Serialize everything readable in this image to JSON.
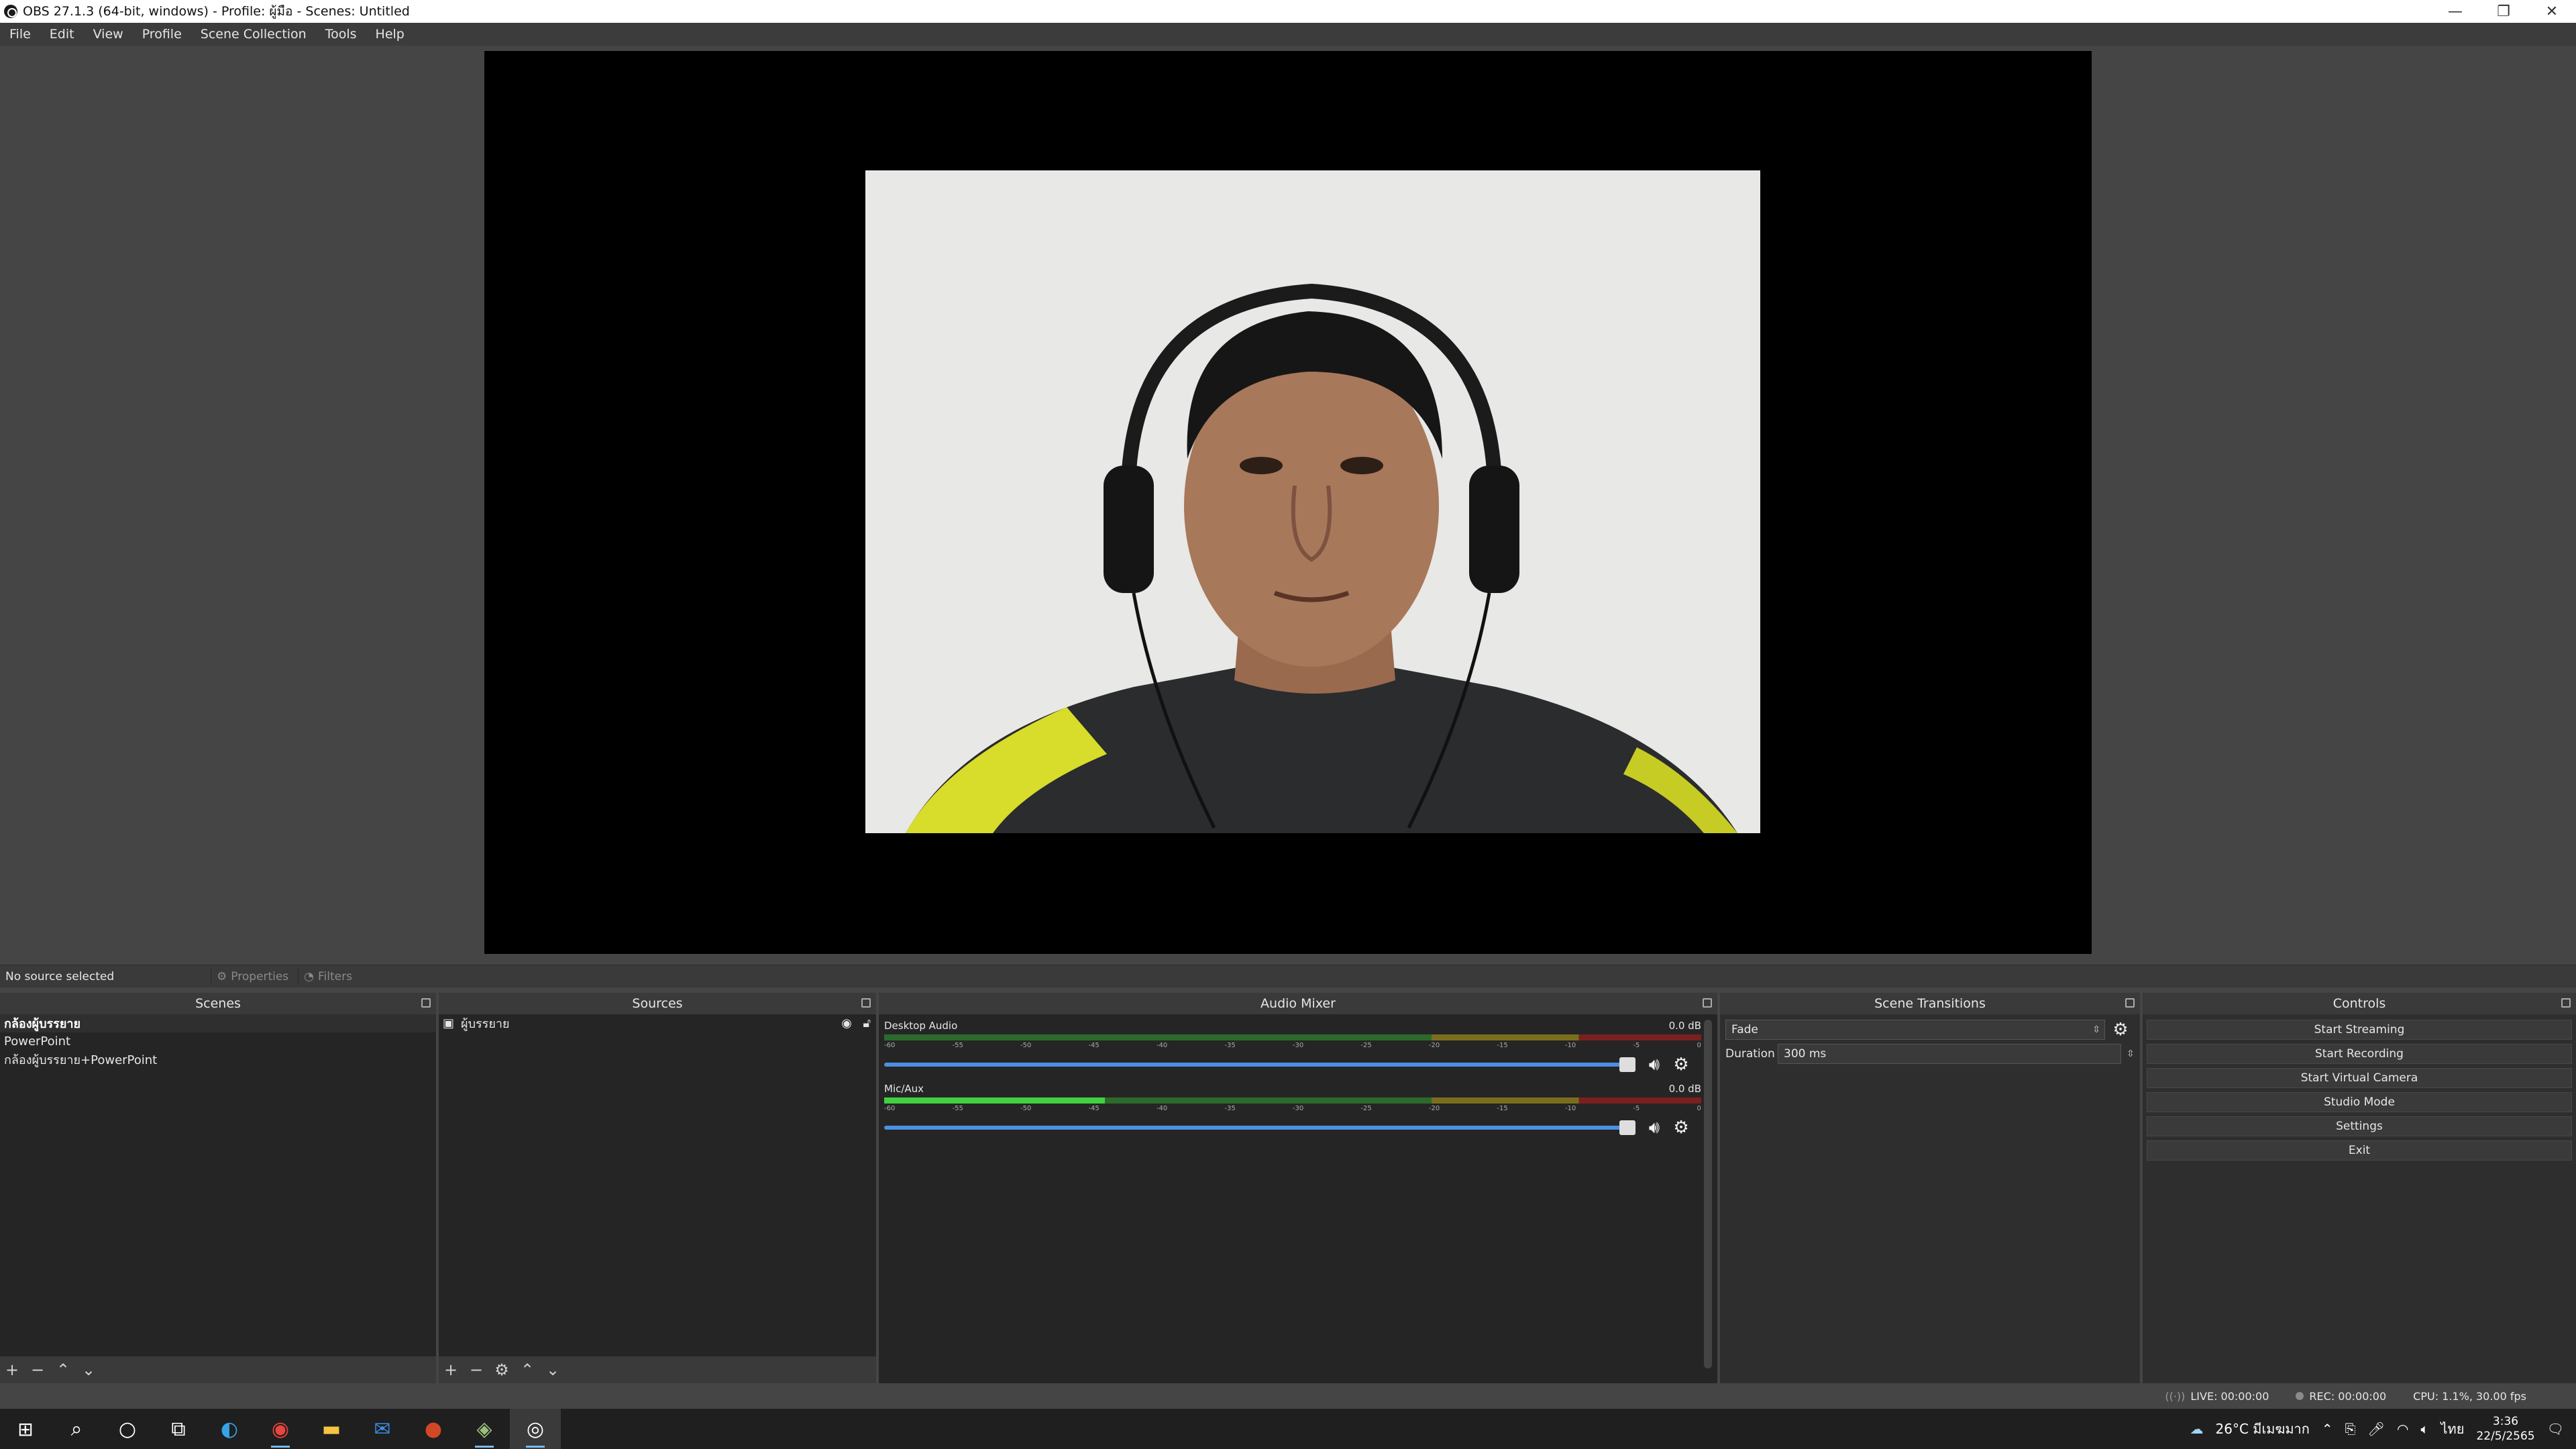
{
  "window": {
    "title": "OBS 27.1.3 (64-bit, windows) - Profile: ผู้มือ - Scenes: Untitled",
    "minimize_glyph": "—",
    "restore_glyph": "❐",
    "close_glyph": "✕"
  },
  "menu": [
    "File",
    "Edit",
    "View",
    "Profile",
    "Scene Collection",
    "Tools",
    "Help"
  ],
  "source_toolbar": {
    "status": "No source selected",
    "properties_label": "Properties",
    "filters_label": "Filters"
  },
  "scenes": {
    "title": "Scenes",
    "items": [
      {
        "label": "กล้องผู้บรรยาย",
        "selected": true
      },
      {
        "label": "PowerPoint",
        "selected": false
      },
      {
        "label": "กล้องผู้บรรยาย+PowerPoint",
        "selected": false
      }
    ]
  },
  "sources": {
    "title": "Sources",
    "items": [
      {
        "label": "ผู้บรรยาย"
      }
    ]
  },
  "mixer": {
    "title": "Audio Mixer",
    "channels": [
      {
        "name": "Desktop Audio",
        "db": "0.0 dB",
        "level": 0
      },
      {
        "name": "Mic/Aux",
        "db": "0.0 dB",
        "level": 0.27
      }
    ],
    "ticks": [
      "-60",
      "-55",
      "-50",
      "-45",
      "-40",
      "-35",
      "-30",
      "-25",
      "-20",
      "-15",
      "-10",
      "-5",
      "0"
    ]
  },
  "transitions": {
    "title": "Scene Transitions",
    "selected": "Fade",
    "duration_label": "Duration",
    "duration_value": "300 ms"
  },
  "controls": {
    "title": "Controls",
    "buttons": [
      "Start Streaming",
      "Start Recording",
      "Start Virtual Camera",
      "Studio Mode",
      "Settings",
      "Exit"
    ]
  },
  "status": {
    "live": "LIVE: 00:00:00",
    "rec": "REC: 00:00:00",
    "cpu": "CPU: 1.1%, 30.00 fps"
  },
  "taskbar": {
    "weather": "26°C มีเมฆมาก",
    "lang": "ไทย",
    "time": "3:36",
    "date": "22/5/2565"
  },
  "colors": {
    "accent": "#4a90e2",
    "meter_active": "#42d142",
    "panel_bg": "#2e2e2e"
  }
}
